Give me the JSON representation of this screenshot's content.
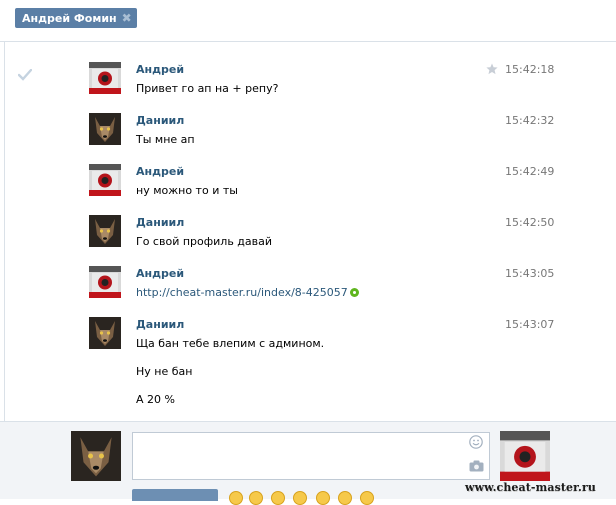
{
  "header": {
    "recipient_chip": "Андрей Фомин",
    "close_symbol": "✖"
  },
  "messages": [
    {
      "author": "Андрей",
      "time": "15:42:18",
      "lines": [
        "Привет го ап на + репу?"
      ],
      "avatar": "andrey"
    },
    {
      "author": "Даниил",
      "time": "15:42:32",
      "lines": [
        "Ты мне ап"
      ],
      "avatar": "daniil"
    },
    {
      "author": "Андрей",
      "time": "15:42:49",
      "lines": [
        "ну можно то и ты"
      ],
      "avatar": "andrey"
    },
    {
      "author": "Даниил",
      "time": "15:42:50",
      "lines": [
        "Го свой профиль давай"
      ],
      "avatar": "daniil"
    },
    {
      "author": "Андрей",
      "time": "15:43:05",
      "lines": [
        "http://cheat-master.ru/index/8-425057"
      ],
      "avatar": "andrey"
    },
    {
      "author": "Даниил",
      "time": "15:43:07",
      "lines": [
        "Ща бан тебе влепим с админом.",
        "Ну не бан",
        "А 20 %"
      ],
      "avatar": "daniil"
    }
  ],
  "composer": {
    "message_value": "",
    "message_placeholder": ""
  },
  "watermark": "www.cheat-master.ru",
  "colors": {
    "accent": "#5b7fa6",
    "author_name": "#2b587a",
    "link": "#2b587a",
    "timestamp": "#777777",
    "panel_bg": "#f2f4f7"
  },
  "icons": [
    "close-icon",
    "checkmark-icon",
    "star-icon",
    "smile-icon",
    "camera-icon",
    "link-ok-icon"
  ]
}
